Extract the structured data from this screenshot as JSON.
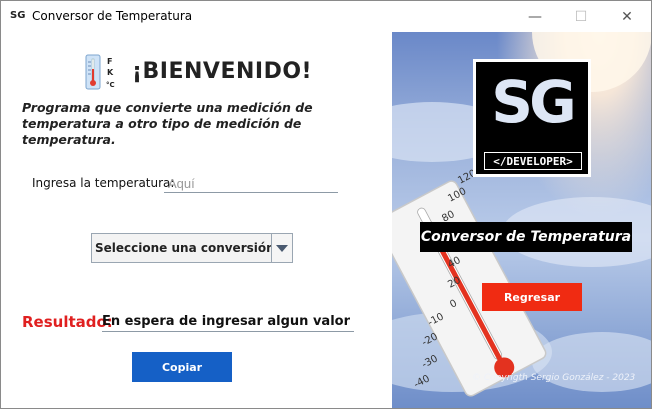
{
  "window": {
    "title": "Conversor de Temperatura",
    "icon_text": "SG",
    "controls": {
      "minimize": "—",
      "maximize": "☐",
      "close": "✕"
    }
  },
  "left": {
    "heading": "¡BIENVENIDO!",
    "thermo_icon_letters": "F K °C",
    "description": "Programa que convierte una medición de temperatura a otro tipo de medición de temperatura.",
    "temperature_label": "Ingresa la temperatura:",
    "temperature_input": {
      "value": "",
      "placeholder": "Aquí"
    },
    "conversion_select": {
      "selected": "Seleccione una conversión"
    },
    "result_label": "Resultado:",
    "result_value": "En espera de ingresar algun valor a convertir",
    "copy_button": "Copiar"
  },
  "right": {
    "logo_letters": "SG",
    "logo_tag": "</DEVELOPER>",
    "banner": "Conversor de Temperatura",
    "back_button": "Regresar",
    "copyright": "© Copyrigth Sergio González - 2023",
    "thermometer_scale": [
      "120",
      "100",
      "80",
      "60",
      "40",
      "20",
      "0",
      "-10",
      "-20",
      "-30",
      "-40"
    ]
  },
  "colors": {
    "copy_button": "#1560c6",
    "back_button": "#f02b12",
    "result_label": "#e02020"
  }
}
